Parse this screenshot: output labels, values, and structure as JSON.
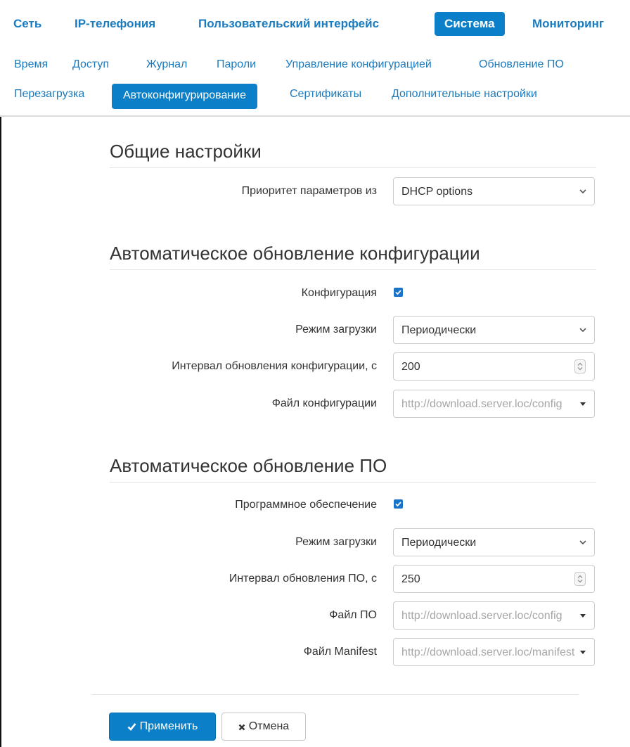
{
  "colors": {
    "accent": "#0b7fc7",
    "link": "#1a7bbf",
    "checkbox": "#1a73c8",
    "text": "#333333",
    "placeholder": "#a6a6a6"
  },
  "main_tabs": [
    {
      "label": "Сеть",
      "active": false
    },
    {
      "label": "IP-телефония",
      "active": false
    },
    {
      "label": "Пользовательский интерфейс",
      "active": false
    },
    {
      "label": "Система",
      "active": true
    },
    {
      "label": "Мониторинг",
      "active": false
    }
  ],
  "sub_tabs_row1": [
    {
      "label": "Время"
    },
    {
      "label": "Доступ"
    },
    {
      "label": "Журнал"
    },
    {
      "label": "Пароли"
    },
    {
      "label": "Управление конфигурацией"
    },
    {
      "label": "Обновление ПО"
    }
  ],
  "sub_tabs_row2": [
    {
      "label": "Перезагрузка",
      "active": false
    },
    {
      "label": "Автоконфигурирование",
      "active": true
    },
    {
      "label": "Сертификаты",
      "active": false
    },
    {
      "label": "Дополнительные настройки",
      "active": false
    }
  ],
  "general": {
    "title": "Общие настройки",
    "priority_label": "Приоритет параметров из",
    "priority_value": "DHCP options"
  },
  "config_update": {
    "title": "Автоматическое обновление конфигурации",
    "enable_label": "Конфигурация",
    "enabled": true,
    "mode_label": "Режим загрузки",
    "mode_value": "Периодически",
    "interval_label": "Интервал обновления конфигурации, с",
    "interval_value": "200",
    "file_label": "Файл конфигурации",
    "file_value": "http://download.server.loc/config"
  },
  "fw_update": {
    "title": "Автоматическое обновление ПО",
    "enable_label": "Программное обеспечение",
    "enabled": true,
    "mode_label": "Режим загрузки",
    "mode_value": "Периодически",
    "interval_label": "Интервал обновления ПО, с",
    "interval_value": "250",
    "file_label": "Файл ПО",
    "file_value": "http://download.server.loc/config",
    "manifest_label": "Файл Manifest",
    "manifest_value": "http://download.server.loc/manifest"
  },
  "actions": {
    "apply_label": "Применить",
    "apply_icon": "checkmark-icon",
    "cancel_label": "Отмена",
    "cancel_icon": "close-icon"
  }
}
